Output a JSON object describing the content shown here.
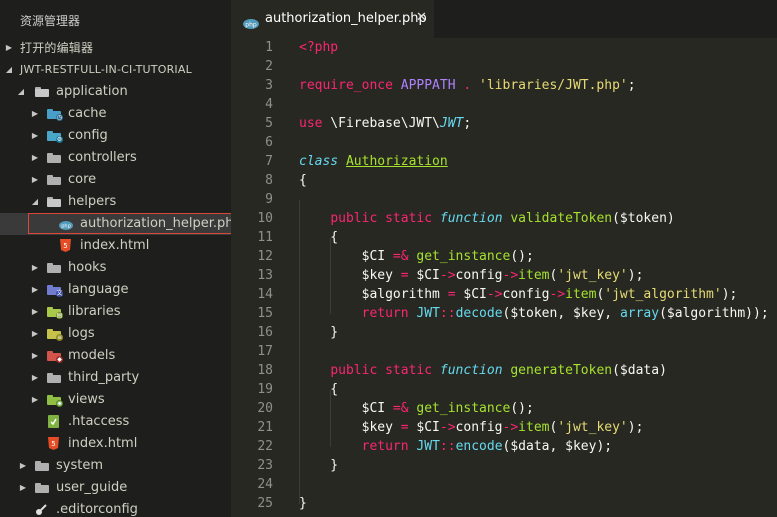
{
  "sidebar": {
    "title": "资源管理器",
    "sections": {
      "open_editors": "打开的编辑器",
      "project": "JWT-RESTFULL-IN-CI-TUTORIAL"
    },
    "tree": [
      {
        "label": "application"
      },
      {
        "label": "cache"
      },
      {
        "label": "config"
      },
      {
        "label": "controllers"
      },
      {
        "label": "core"
      },
      {
        "label": "helpers"
      },
      {
        "label": "authorization_helper.php"
      },
      {
        "label": "index.html"
      },
      {
        "label": "hooks"
      },
      {
        "label": "language"
      },
      {
        "label": "libraries"
      },
      {
        "label": "logs"
      },
      {
        "label": "models"
      },
      {
        "label": "third_party"
      },
      {
        "label": "views"
      },
      {
        "label": ".htaccess"
      },
      {
        "label": "index.html"
      },
      {
        "label": "system"
      },
      {
        "label": "user_guide"
      },
      {
        "label": ".editorconfig"
      }
    ]
  },
  "tab": {
    "label": "authorization_helper.php",
    "close": "✕",
    "icon_text": "php"
  },
  "editor": {
    "lines": [
      {
        "n": "1",
        "code": [
          "<?php"
        ]
      },
      {
        "n": "2",
        "code": []
      },
      {
        "n": "3",
        "code": [
          "require_once",
          " ",
          "APPPATH",
          " . ",
          "'libraries/JWT.php'",
          ";"
        ]
      },
      {
        "n": "4",
        "code": []
      },
      {
        "n": "5",
        "code": [
          "use",
          " \\Firebase\\JWT\\",
          "JWT",
          ";"
        ]
      },
      {
        "n": "6",
        "code": []
      },
      {
        "n": "7",
        "code": [
          "class",
          " ",
          "Authorization"
        ]
      },
      {
        "n": "8",
        "code": [
          "{"
        ]
      },
      {
        "n": "9",
        "code": []
      },
      {
        "n": "10",
        "code": [
          "    ",
          "public",
          " ",
          "static",
          " ",
          "function",
          " ",
          "validateToken",
          "($token)"
        ]
      },
      {
        "n": "11",
        "code": [
          "    {"
        ]
      },
      {
        "n": "12",
        "code": [
          "        $CI ",
          "=&",
          " ",
          "get_instance",
          "();"
        ]
      },
      {
        "n": "13",
        "code": [
          "        $key ",
          "=",
          " $CI",
          "->",
          "config",
          "->",
          "item",
          "(",
          "'jwt_key'",
          ");"
        ]
      },
      {
        "n": "14",
        "code": [
          "        $algorithm ",
          "=",
          " $CI",
          "->",
          "config",
          "->",
          "item",
          "(",
          "'jwt_algorithm'",
          ");"
        ]
      },
      {
        "n": "15",
        "code": [
          "        ",
          "return",
          " ",
          "JWT",
          "::",
          "decode",
          "($token, $key, ",
          "array",
          "($algorithm));"
        ]
      },
      {
        "n": "16",
        "code": [
          "    }"
        ]
      },
      {
        "n": "17",
        "code": []
      },
      {
        "n": "18",
        "code": [
          "    ",
          "public",
          " ",
          "static",
          " ",
          "function",
          " ",
          "generateToken",
          "($data)"
        ]
      },
      {
        "n": "19",
        "code": [
          "    {"
        ]
      },
      {
        "n": "20",
        "code": [
          "        $CI ",
          "=&",
          " ",
          "get_instance",
          "();"
        ]
      },
      {
        "n": "21",
        "code": [
          "        $key ",
          "=",
          " $CI",
          "->",
          "config",
          "->",
          "item",
          "(",
          "'jwt_key'",
          ");"
        ]
      },
      {
        "n": "22",
        "code": [
          "        ",
          "return",
          " ",
          "JWT",
          "::",
          "encode",
          "($data, $key);"
        ]
      },
      {
        "n": "23",
        "code": [
          "    }"
        ]
      },
      {
        "n": "24",
        "code": []
      },
      {
        "n": "25",
        "code": [
          "}"
        ]
      }
    ]
  },
  "colors": {
    "sidebar_bg": "#1e1f1c",
    "editor_bg": "#272822",
    "selection_border": "#d9463a",
    "php_icon": "#519aba",
    "html_icon": "#e44d26"
  },
  "icons": {
    "folder": "folder-icon",
    "php_file": "php-file-icon",
    "html_file": "html-file-icon",
    "config_file": "editorconfig-icon",
    "htaccess": "htaccess-icon"
  }
}
